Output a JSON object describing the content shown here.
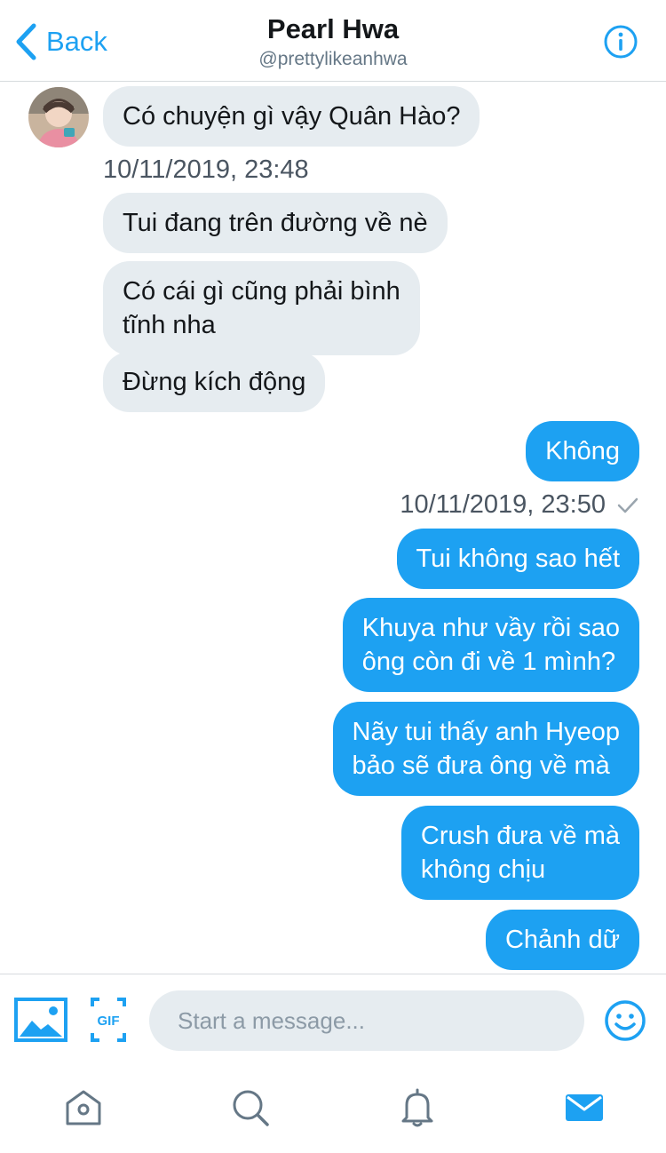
{
  "header": {
    "back_label": "Back",
    "name": "Pearl Hwa",
    "handle": "@prettylikeanhwa",
    "info_icon": "info-icon"
  },
  "conversation": {
    "incoming": [
      "Có chuyện gì vậy Quân Hào?",
      "Tui đang trên đường về nè",
      "Có cái gì cũng phải bình\ntĩnh nha",
      "Đừng kích động"
    ],
    "incoming_timestamp": "10/11/2019, 23:48",
    "outgoing": [
      "Không",
      "Tui không sao hết",
      "Khuya như vầy rồi sao\nông còn đi về 1 mình?",
      "Nãy tui thấy anh Hyeop\nbảo sẽ đưa ông về mà",
      "Crush đưa về mà\nkhông chịu",
      "Chảnh dữ"
    ],
    "outgoing_timestamp": "10/11/2019, 23:50"
  },
  "composer": {
    "placeholder": "Start a message...",
    "gif_label": "GIF",
    "icons": [
      "image-icon",
      "gif-icon",
      "emoji-icon"
    ]
  },
  "tabbar": {
    "tabs": [
      "home-icon",
      "search-icon",
      "notifications-icon",
      "messages-icon"
    ],
    "active": "messages-icon"
  },
  "colors": {
    "accent": "#1da1f2",
    "incoming_bubble": "#e6ecf0",
    "secondary_text": "#657786"
  }
}
